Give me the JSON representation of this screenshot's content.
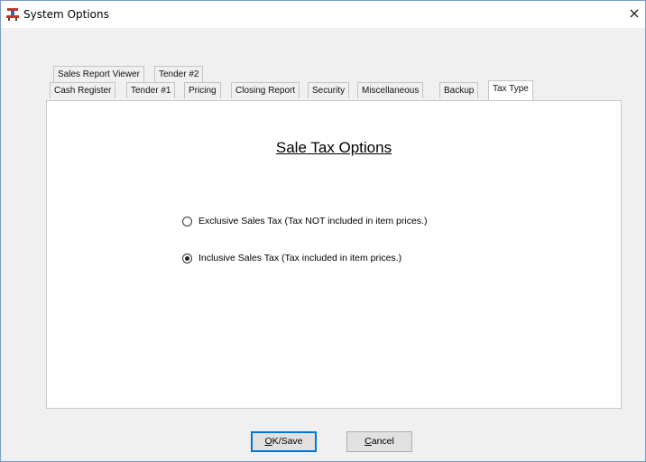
{
  "window": {
    "title": "System Options",
    "close_glyph": "×",
    "icon": "register-icon"
  },
  "tabs": {
    "row_top": [
      "Sales Report Viewer",
      "Tender #2"
    ],
    "row_bottom": [
      "Cash Register",
      "Tender #1",
      "Pricing",
      "Closing Report",
      "Security",
      "Miscellaneous",
      "Backup",
      "Tax Type"
    ],
    "active": "Tax Type"
  },
  "panel": {
    "heading": "Sale Tax Options",
    "options": [
      {
        "label": "Exclusive Sales Tax (Tax NOT included in item prices.)",
        "checked": false
      },
      {
        "label": "Inclusive Sales Tax (Tax included in item prices.)",
        "checked": true
      }
    ]
  },
  "buttons": {
    "ok_mnemonic": "O",
    "ok_rest": "K/Save",
    "cancel_mnemonic": "C",
    "cancel_rest": "ancel"
  }
}
